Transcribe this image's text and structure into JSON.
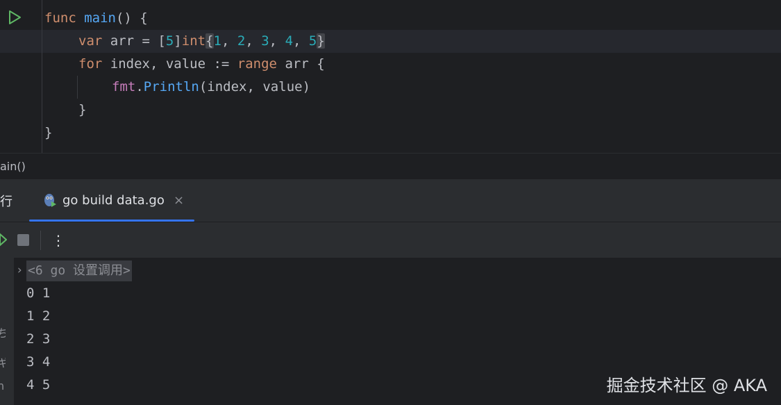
{
  "editor": {
    "lines": {
      "l1": {
        "kw": "func",
        "fn": "main",
        "rest": "() {"
      },
      "l2": {
        "kw": "var",
        "a": " arr = [",
        "n": "5",
        "b": "]",
        "type": "int",
        "open": "{",
        "v1": "1",
        "c1": ", ",
        "v2": "2",
        "c2": ", ",
        "v3": "3",
        "c3": ", ",
        "v4": "4",
        "c4": ", ",
        "v5": "5",
        "close": "}"
      },
      "l3": {
        "kw": "for",
        "a": " index, value := ",
        "kw2": "range",
        "b": " arr {"
      },
      "l4": {
        "pkg": "fmt",
        "dot": ".",
        "fn": "Println",
        "args": "(index, value)"
      },
      "l5": {
        "text": "}"
      },
      "l6": {
        "text": "}"
      }
    }
  },
  "breadcrumb": {
    "text": "ain()"
  },
  "run_panel": {
    "title": "行",
    "tab_label": "go build data.go",
    "tab_close": "×",
    "more": "⋮"
  },
  "console": {
    "folded_region": "<6 go 设置调用>",
    "fold_arrow": "›",
    "left_glyphs": [
      "ち",
      "ギ",
      "n"
    ],
    "output": [
      "0 1",
      "1 2",
      "2 3",
      "3 4",
      "4 5"
    ]
  },
  "watermark": "掘金技术社区 @ AKA",
  "icons": {
    "run_gutter": "play-icon",
    "rerun": "rerun-icon",
    "stop": "stop-icon",
    "tab": "gopher-run-icon",
    "more": "more-vertical-icon"
  },
  "colors": {
    "keyword": "#cf8e6d",
    "function": "#56a8f5",
    "number": "#2aacb8",
    "package": "#c77dbb",
    "accent": "#3574f0",
    "run_green": "#5fb865"
  }
}
